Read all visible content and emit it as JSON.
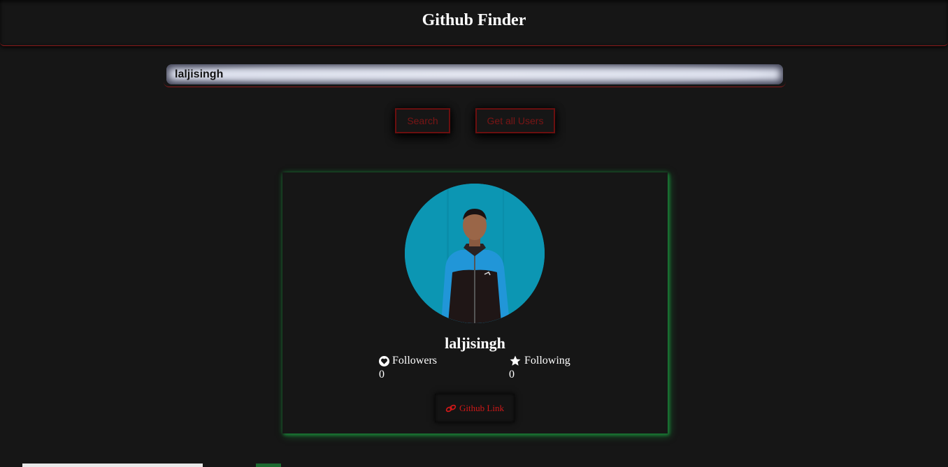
{
  "app": {
    "title": "Github Finder"
  },
  "search": {
    "value": "laljisingh",
    "search_label": "Search",
    "get_all_label": "Get all Users"
  },
  "profile": {
    "username": "laljisingh",
    "followers_label": "Followers",
    "followers_count": "0",
    "following_label": "Following",
    "following_count": "0",
    "link_label": "Github Link"
  },
  "colors": {
    "background": "#161616",
    "accent_red": "#d01818",
    "card_glow": "#1eaa46",
    "avatar_bg": "#0b93b0"
  },
  "icons": {
    "followers": "heart-icon",
    "following": "star-icon",
    "link": "link-icon"
  }
}
